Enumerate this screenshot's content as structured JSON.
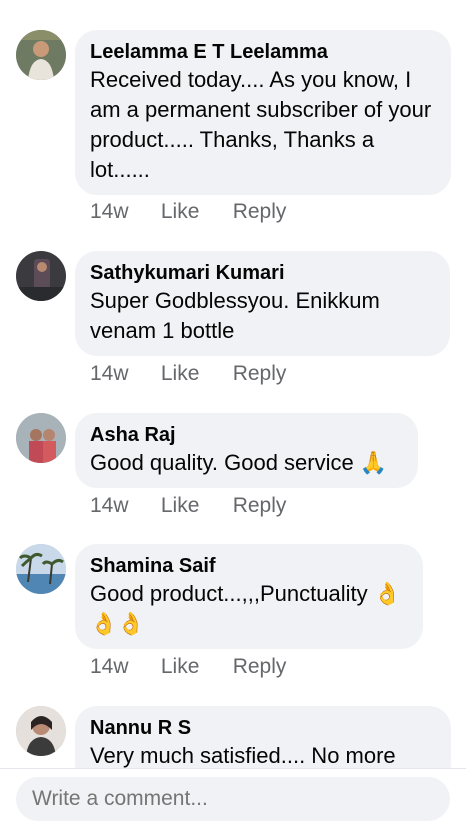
{
  "comments": [
    {
      "author": "Leelamma E T Leelamma",
      "text": "Received today.... As you know, I am a permanent subscriber of your product..... Thanks,  Thanks a lot......",
      "time": "14w",
      "like": "Like",
      "reply": "Reply"
    },
    {
      "author": "Sathykumari Kumari",
      "text": "Super Godblessyou. Enikkum venam 1 bottle",
      "time": "14w",
      "like": "Like",
      "reply": "Reply"
    },
    {
      "author": "Asha Raj",
      "text": "Good quality. Good service 🙏",
      "time": "14w",
      "like": "Like",
      "reply": "Reply"
    },
    {
      "author": "Shamina Saif",
      "text": "Good product...,,,Punctuality 👌👌👌",
      "time": "14w",
      "like": "Like",
      "reply": "Reply"
    },
    {
      "author": "Nannu R S",
      "text": "Very much satisfied.... No more"
    }
  ],
  "composer": {
    "placeholder": "Write a comment..."
  }
}
